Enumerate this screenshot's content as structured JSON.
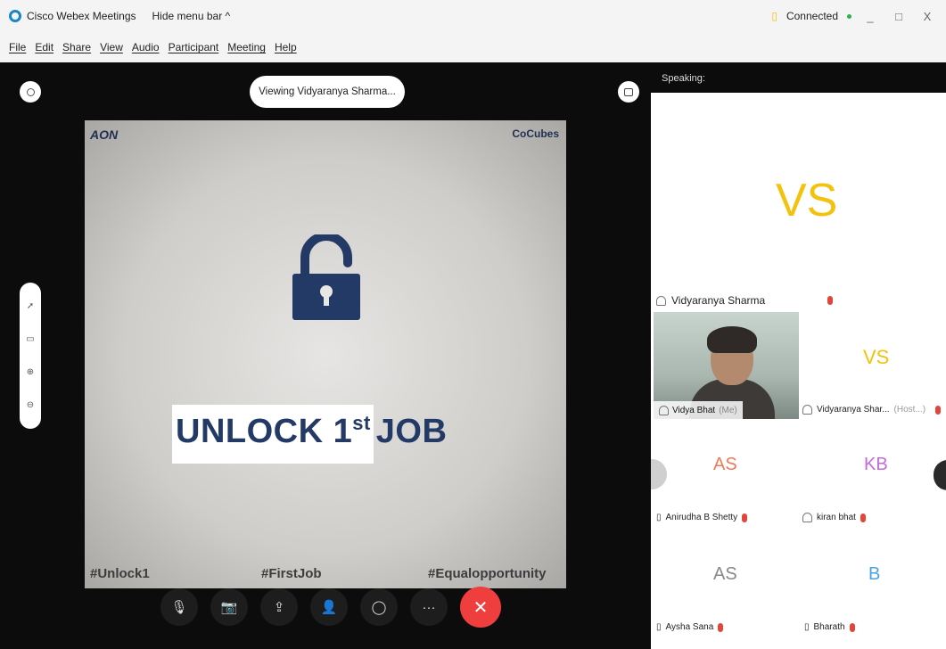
{
  "titlebar": {
    "app_title": "Cisco Webex Meetings",
    "hide_menu": "Hide menu bar ^",
    "status": "Connected",
    "status_color": "#2bb24c",
    "minimize": "_",
    "maximize": "□",
    "close": "X"
  },
  "menu": {
    "items": [
      "File",
      "Edit",
      "Share",
      "View",
      "Audio",
      "Participant",
      "Meeting",
      "Help"
    ]
  },
  "stage": {
    "viewing_label": "Viewing Vidyaranya Sharma...",
    "shared": {
      "brand_left": "AON",
      "brand_right": "CoCubes",
      "headline_main": "UNLOCK 1",
      "headline_sup": "st",
      "headline_end": "JOB",
      "hashtags": [
        "#Unlock1",
        "#FirstJob",
        "#Equalopportunity"
      ]
    },
    "left_tools": [
      "pointer-icon",
      "eraser-icon",
      "zoom-in-icon",
      "zoom-out-icon"
    ],
    "controls": [
      {
        "name": "mute-button",
        "icon": "microphone-muted-icon",
        "glyph": "🎙"
      },
      {
        "name": "video-button",
        "icon": "camera-off-icon",
        "glyph": "📷"
      },
      {
        "name": "share-button",
        "icon": "share-icon",
        "glyph": "⇪"
      },
      {
        "name": "participants-button",
        "icon": "participants-icon",
        "glyph": "👤"
      },
      {
        "name": "chat-button",
        "icon": "chat-icon",
        "glyph": "◯"
      },
      {
        "name": "more-button",
        "icon": "more-icon",
        "glyph": "···"
      },
      {
        "name": "end-button",
        "icon": "close-icon",
        "glyph": "✕"
      }
    ],
    "end_color": "#ef3e3e"
  },
  "panel": {
    "speaking_label": "Speaking:",
    "active_speaker": {
      "initials": "VS",
      "name": "Vidyaranya Sharma",
      "color": "#f3c20f"
    },
    "tiles": [
      {
        "name": "Vidya Bhat",
        "suffix": "(Me)",
        "initials": "",
        "color": ""
      },
      {
        "name": "Vidyaranya Shar...",
        "suffix": "(Host...)",
        "initials": "VS",
        "color": "#f3c20f"
      },
      {
        "name": "Anirudha B Shetty",
        "suffix": "",
        "initials": "AS",
        "color": "#f07a5a"
      },
      {
        "name": "kiran bhat",
        "suffix": "",
        "initials": "KB",
        "color": "#c46ad8"
      },
      {
        "name": "Aysha Sana",
        "suffix": "",
        "initials": "AS",
        "color": "#888888"
      },
      {
        "name": "Bharath",
        "suffix": "",
        "initials": "B",
        "color": "#4aa3e0"
      }
    ]
  }
}
